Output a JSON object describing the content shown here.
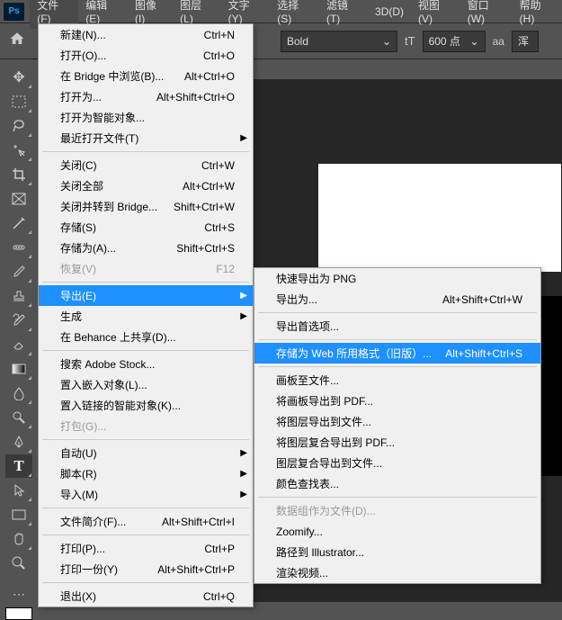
{
  "app": {
    "logo": "Ps"
  },
  "menubar": [
    "文件(F)",
    "编辑(E)",
    "图像(I)",
    "图层(L)",
    "文字(Y)",
    "选择(S)",
    "滤镜(T)",
    "3D(D)",
    "视图(V)",
    "窗口(W)",
    "帮助(H)"
  ],
  "options": {
    "weight": "Bold",
    "size": "600 点",
    "unit_icon": "tT",
    "aa": "aa",
    "other": "浑"
  },
  "file_menu": [
    {
      "label": "新建(N)...",
      "sc": "Ctrl+N"
    },
    {
      "label": "打开(O)...",
      "sc": "Ctrl+O"
    },
    {
      "label": "在 Bridge 中浏览(B)...",
      "sc": "Alt+Ctrl+O"
    },
    {
      "label": "打开为...",
      "sc": "Alt+Shift+Ctrl+O"
    },
    {
      "label": "打开为智能对象..."
    },
    {
      "label": "最近打开文件(T)",
      "arrow": true
    },
    {
      "sep": true
    },
    {
      "label": "关闭(C)",
      "sc": "Ctrl+W"
    },
    {
      "label": "关闭全部",
      "sc": "Alt+Ctrl+W"
    },
    {
      "label": "关闭并转到 Bridge...",
      "sc": "Shift+Ctrl+W"
    },
    {
      "label": "存储(S)",
      "sc": "Ctrl+S"
    },
    {
      "label": "存储为(A)...",
      "sc": "Shift+Ctrl+S"
    },
    {
      "label": "恢复(V)",
      "sc": "F12",
      "disabled": true
    },
    {
      "sep": true
    },
    {
      "label": "导出(E)",
      "arrow": true,
      "hl": true
    },
    {
      "label": "生成",
      "arrow": true
    },
    {
      "label": "在 Behance 上共享(D)..."
    },
    {
      "sep": true
    },
    {
      "label": "搜索 Adobe Stock..."
    },
    {
      "label": "置入嵌入对象(L)..."
    },
    {
      "label": "置入链接的智能对象(K)..."
    },
    {
      "label": "打包(G)...",
      "disabled": true
    },
    {
      "sep": true
    },
    {
      "label": "自动(U)",
      "arrow": true
    },
    {
      "label": "脚本(R)",
      "arrow": true
    },
    {
      "label": "导入(M)",
      "arrow": true
    },
    {
      "sep": true
    },
    {
      "label": "文件简介(F)...",
      "sc": "Alt+Shift+Ctrl+I"
    },
    {
      "sep": true
    },
    {
      "label": "打印(P)...",
      "sc": "Ctrl+P"
    },
    {
      "label": "打印一份(Y)",
      "sc": "Alt+Shift+Ctrl+P"
    },
    {
      "sep": true
    },
    {
      "label": "退出(X)",
      "sc": "Ctrl+Q"
    }
  ],
  "export_menu": [
    {
      "label": "快速导出为 PNG"
    },
    {
      "label": "导出为...",
      "sc": "Alt+Shift+Ctrl+W"
    },
    {
      "sep": true
    },
    {
      "label": "导出首选项..."
    },
    {
      "sep": true
    },
    {
      "label": "存储为 Web 所用格式（旧版）...",
      "sc": "Alt+Shift+Ctrl+S",
      "hl": true
    },
    {
      "sep": true
    },
    {
      "label": "画板至文件..."
    },
    {
      "label": "将画板导出到 PDF..."
    },
    {
      "label": "将图层导出到文件..."
    },
    {
      "label": "将图层复合导出到 PDF..."
    },
    {
      "label": "图层复合导出到文件..."
    },
    {
      "label": "颜色查找表..."
    },
    {
      "sep": true
    },
    {
      "label": "数据组作为文件(D)...",
      "disabled": true
    },
    {
      "label": "Zoomify..."
    },
    {
      "label": "路径到 Illustrator..."
    },
    {
      "label": "渲染视频..."
    }
  ],
  "tools": [
    "move",
    "marquee",
    "lasso",
    "quick-select",
    "crop",
    "frame",
    "eyedropper",
    "spot-heal",
    "brush",
    "stamp",
    "history-brush",
    "eraser",
    "gradient",
    "blur",
    "dodge",
    "pen",
    "type",
    "path-select",
    "rectangle",
    "hand",
    "zoom"
  ]
}
